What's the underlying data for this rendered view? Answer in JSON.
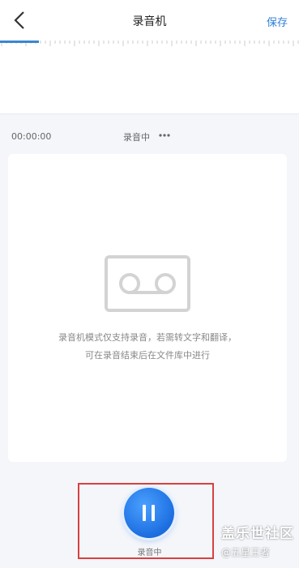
{
  "header": {
    "back_icon": "chevron-left-icon",
    "title": "录音机",
    "save_label": "保存"
  },
  "status": {
    "time": "00:00:00",
    "label": "录音中",
    "dots_icon": "ellipsis-icon"
  },
  "panel": {
    "icon": "voicemail-tape-icon",
    "hint_line1": "录音机模式仅支持录音，若需转文字和翻译，",
    "hint_line2": "可在录音结束后在文件库中进行"
  },
  "control": {
    "button_icon": "pause-icon",
    "label": "录音中"
  },
  "watermark": {
    "main": "盖乐世社区",
    "sub": "@五星王者"
  },
  "colors": {
    "accent": "#2f7fd9",
    "button": "#1c6ee0",
    "highlight": "#d94040"
  }
}
